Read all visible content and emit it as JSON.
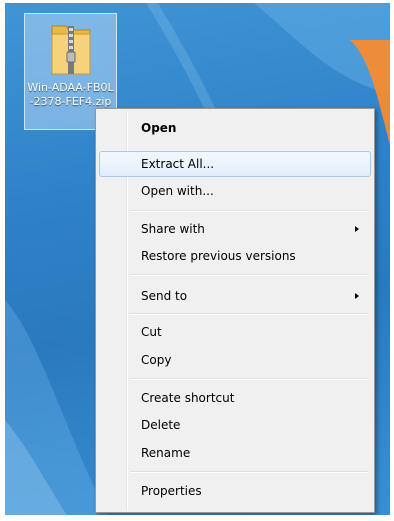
{
  "desktop": {
    "icon": {
      "name": "zip-folder-icon",
      "label": "Win-ADAA-FB0L-2378-FEF4.zip"
    }
  },
  "context_menu": {
    "open": "Open",
    "extract_all": "Extract All...",
    "open_with": "Open with...",
    "share_with": "Share with",
    "restore_previous_versions": "Restore previous versions",
    "send_to": "Send to",
    "cut": "Cut",
    "copy": "Copy",
    "create_shortcut": "Create shortcut",
    "delete": "Delete",
    "rename": "Rename",
    "properties": "Properties",
    "submenu_arrow_icon": "chevron-right-icon",
    "highlighted_item": "extract_all"
  },
  "colors": {
    "desktop": "#2f82c8",
    "menu_background": "#f0f0f0",
    "menu_border": "#979797",
    "hover_border": "#a8c8ec",
    "selection": "#b4d7f5"
  }
}
